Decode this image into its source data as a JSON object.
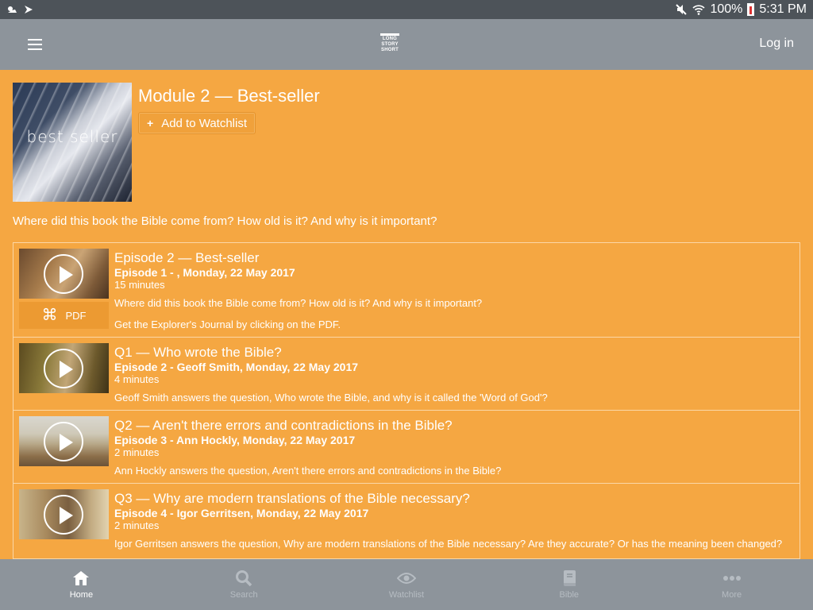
{
  "status": {
    "battery": "100%",
    "time": "5:31 PM"
  },
  "app": {
    "logo_lines": [
      "LONG",
      "STORY",
      "SHORT"
    ],
    "login": "Log in"
  },
  "module": {
    "thumb_title": "best seller",
    "title": "Module 2 — Best-seller",
    "watchlist": "Add to Watchlist",
    "description": "Where did this book the Bible come from? How old is it? And why is it important?"
  },
  "episodes": [
    {
      "title": "Episode 2 — Best-seller",
      "meta": "Episode 1 - , Monday, 22 May 2017",
      "duration": "15 minutes",
      "description": "Where did this book the Bible come from? How old is it? And why is it important?",
      "pdf_label": "PDF",
      "note": "Get the Explorer's Journal by clicking on the PDF."
    },
    {
      "title": "Q1 — Who wrote the Bible?",
      "meta": "Episode 2 - Geoff Smith, Monday, 22 May 2017",
      "duration": "4 minutes",
      "description": "Geoff Smith answers the question, Who wrote the Bible, and why is it called the 'Word of God'?"
    },
    {
      "title": "Q2 — Aren't there errors and contradictions in the Bible?",
      "meta": "Episode 3 - Ann Hockly, Monday, 22 May 2017",
      "duration": "2 minutes",
      "description": "Ann Hockly answers the question, Aren't there errors and contradictions in the Bible?"
    },
    {
      "title": "Q3 — Why are modern translations of the Bible necessary?",
      "meta": "Episode 4 - Igor Gerritsen, Monday, 22 May 2017",
      "duration": "2 minutes",
      "description": "Igor Gerritsen answers the question, Why are modern translations of the Bible necessary? Are they accurate? Or has the meaning been changed?"
    }
  ],
  "nav": [
    {
      "label": "Home",
      "icon": "home-icon"
    },
    {
      "label": "Search",
      "icon": "search-icon"
    },
    {
      "label": "Watchlist",
      "icon": "eye-icon"
    },
    {
      "label": "Bible",
      "icon": "book-icon"
    },
    {
      "label": "More",
      "icon": "more-icon"
    }
  ],
  "colors": {
    "background": "#f5a742",
    "appbar": "#8d949b",
    "statusbar": "#4d5359"
  }
}
